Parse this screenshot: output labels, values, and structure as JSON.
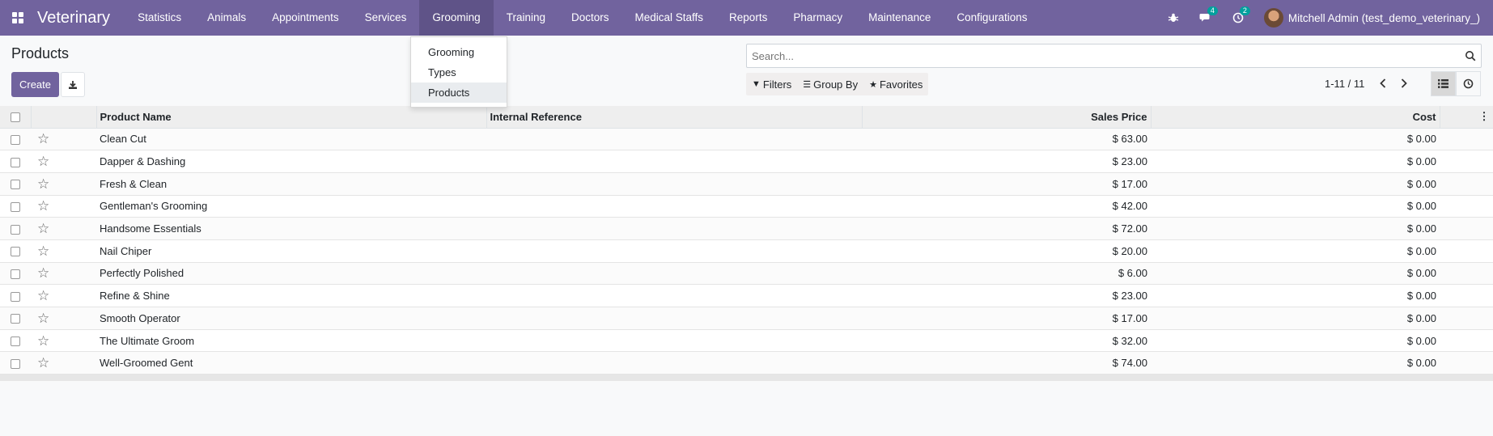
{
  "app": {
    "name": "Veterinary"
  },
  "menu": [
    {
      "label": "Statistics"
    },
    {
      "label": "Animals"
    },
    {
      "label": "Appointments"
    },
    {
      "label": "Services"
    },
    {
      "label": "Grooming"
    },
    {
      "label": "Training"
    },
    {
      "label": "Doctors"
    },
    {
      "label": "Medical Staffs"
    },
    {
      "label": "Reports"
    },
    {
      "label": "Pharmacy"
    },
    {
      "label": "Maintenance"
    },
    {
      "label": "Configurations"
    }
  ],
  "systray": {
    "messages_count": "4",
    "activities_count": "2",
    "user": "Mitchell Admin (test_demo_veterinary_)"
  },
  "dropdown": {
    "items": [
      {
        "label": "Grooming"
      },
      {
        "label": "Types"
      },
      {
        "label": "Products"
      }
    ]
  },
  "page": {
    "title": "Products",
    "create_label": "Create"
  },
  "search": {
    "placeholder": "Search..."
  },
  "filters": {
    "filters_label": "Filters",
    "groupby_label": "Group By",
    "favorites_label": "Favorites"
  },
  "pager": {
    "value": "1-11 / 11"
  },
  "table": {
    "headers": {
      "name": "Product Name",
      "ref": "Internal Reference",
      "price": "Sales Price",
      "cost": "Cost"
    },
    "rows": [
      {
        "name": "Clean Cut",
        "ref": "",
        "price": "$ 63.00",
        "cost": "$ 0.00"
      },
      {
        "name": "Dapper & Dashing",
        "ref": "",
        "price": "$ 23.00",
        "cost": "$ 0.00"
      },
      {
        "name": "Fresh & Clean",
        "ref": "",
        "price": "$ 17.00",
        "cost": "$ 0.00"
      },
      {
        "name": "Gentleman's Grooming",
        "ref": "",
        "price": "$ 42.00",
        "cost": "$ 0.00"
      },
      {
        "name": "Handsome Essentials",
        "ref": "",
        "price": "$ 72.00",
        "cost": "$ 0.00"
      },
      {
        "name": "Nail Chiper",
        "ref": "",
        "price": "$ 20.00",
        "cost": "$ 0.00"
      },
      {
        "name": "Perfectly Polished",
        "ref": "",
        "price": "$ 6.00",
        "cost": "$ 0.00"
      },
      {
        "name": "Refine & Shine",
        "ref": "",
        "price": "$ 23.00",
        "cost": "$ 0.00"
      },
      {
        "name": "Smooth Operator",
        "ref": "",
        "price": "$ 17.00",
        "cost": "$ 0.00"
      },
      {
        "name": "The Ultimate Groom",
        "ref": "",
        "price": "$ 32.00",
        "cost": "$ 0.00"
      },
      {
        "name": "Well-Groomed Gent",
        "ref": "",
        "price": "$ 74.00",
        "cost": "$ 0.00"
      }
    ]
  }
}
